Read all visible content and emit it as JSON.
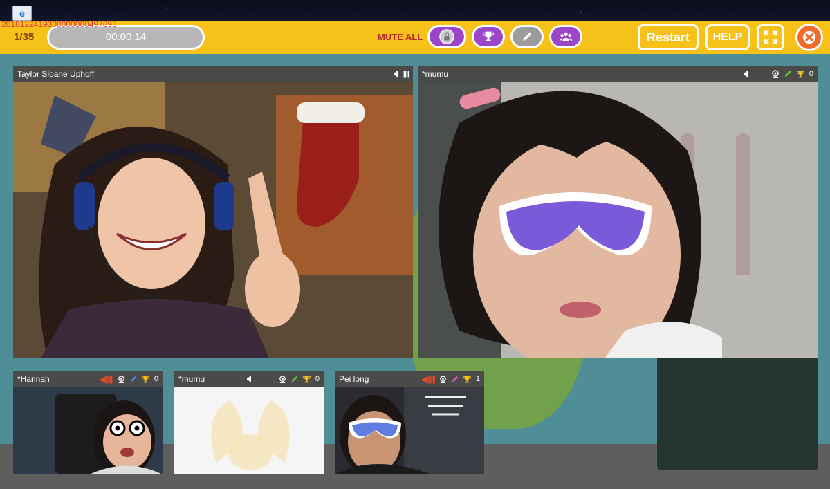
{
  "desktop": {
    "session_id": "2018122419300000000497893",
    "icon": "browser-shortcut-icon"
  },
  "toolbar": {
    "page_counter": "1/35",
    "timer": "00:00:14",
    "mute_all_label": "MUTE ALL",
    "restart_label": "Restart",
    "help_label": "HELP",
    "icons": [
      "lock-icon",
      "trophy-icon",
      "pen-icon",
      "group-icon",
      "fullscreen-icon",
      "close-icon"
    ],
    "colors": {
      "bar": "#f6c21a",
      "accent": "#9b45c8",
      "close": "#f26b2a"
    }
  },
  "teacher": {
    "name": "Taylor Sloane Uphoff"
  },
  "main_student": {
    "name": "*mumu",
    "trophies": "0"
  },
  "thumbnails": [
    {
      "name": "*Hannah",
      "trophies": "0"
    },
    {
      "name": "*mumu",
      "trophies": "0"
    },
    {
      "name": "Pei long",
      "trophies": "1"
    }
  ]
}
